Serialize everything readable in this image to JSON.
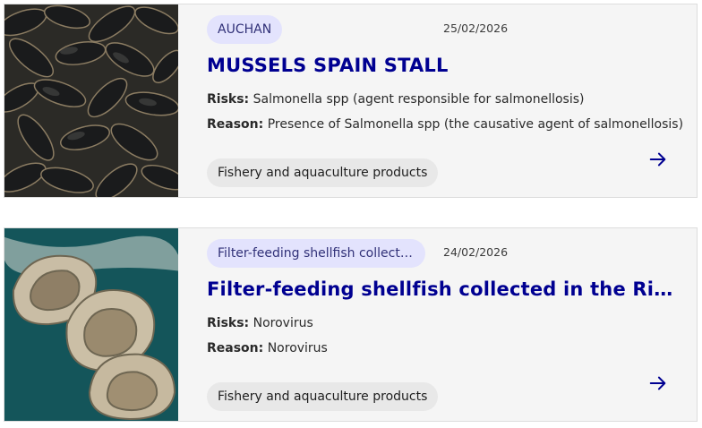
{
  "cards": [
    {
      "image": "mussels-photo",
      "tag": "AUCHAN",
      "date": "25/02/2026",
      "title": "MUSSELS SPAIN STALL",
      "risks_label": "Risks:",
      "risks": "Salmonella spp (agent responsible for salmonellosis)",
      "reason_label": "Reason:",
      "reason": "Presence of Salmonella spp (the causative agent of salmonellosis)",
      "category": "Fishery and aquaculture products",
      "arrow_icon": "arrow-right-icon"
    },
    {
      "image": "oysters-photo",
      "tag": "Filter-feeding shellfish collecte...",
      "date": "24/02/2026",
      "title": "Filter-feeding shellfish collected in the Rivière ...",
      "risks_label": "Risks:",
      "risks": "Norovirus",
      "reason_label": "Reason:",
      "reason": "Norovirus",
      "category": "Fishery and aquaculture products",
      "arrow_icon": "arrow-right-icon"
    }
  ],
  "colors": {
    "accent": "#000091",
    "tag_bg": "#e3e3fd",
    "card_bg": "#f5f5f5",
    "pill_bg": "#e8e8e8"
  }
}
